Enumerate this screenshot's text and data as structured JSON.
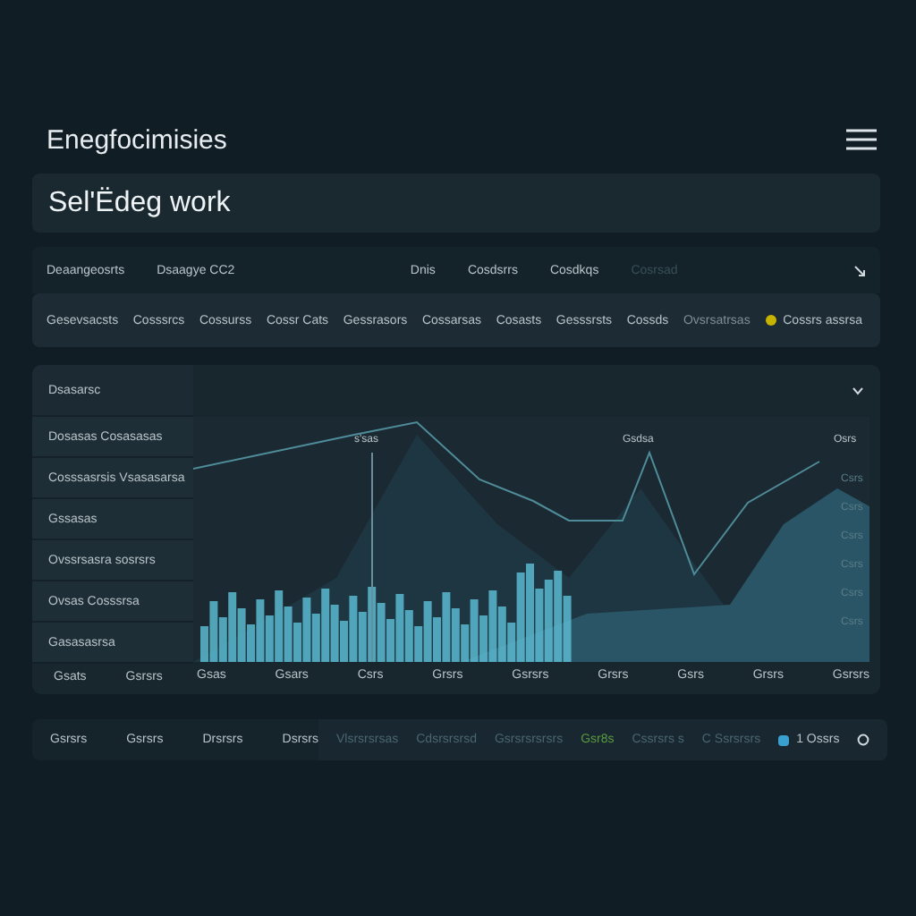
{
  "app_title": "Enegfocimisies",
  "heading": "Sel'Ëdeg work",
  "filter_row": {
    "left": [
      "Deaangeosrts",
      "Dsaagye CC2"
    ],
    "right": [
      "Dnis",
      "Cosdsrrs",
      "Cosdkqs",
      "Cosrsad"
    ]
  },
  "summary_row": {
    "items": [
      "Gesevsacsts",
      "Cosssrcs",
      "Cossurss",
      "Cossr Cats",
      "Gessrasors",
      "Cossarsas",
      "Cosasts",
      "Gesssrsts",
      "Cossds",
      "Ovsrsatrsas"
    ],
    "status": {
      "label": "Cossrs assrsa",
      "color": "#c8b400"
    }
  },
  "panel": {
    "title": "Dsasarsc",
    "list": [
      "Dosasas Cosasasas",
      "Cosssasrsis Vsasasarsa",
      "Gssasas",
      "Ovssrsasra sosrsrs",
      "Ovsas Cosssrsa",
      "Gasasasrsa"
    ],
    "x_labels_left": [
      "Gsats",
      "Gsrsrs"
    ],
    "chart": {
      "peak_labels": [
        "s'sas",
        "Gsdsa",
        "Osrs"
      ],
      "y_labels": [
        "Csrs",
        "Csrs",
        "Csrs",
        "Csrs",
        "Csrs",
        "Csrs"
      ],
      "x_labels": [
        "Gsas",
        "Gsars",
        "Csrs",
        "Grsrs",
        "Gsrsrs",
        "Grsrs",
        "Gsrs",
        "Grsrs",
        "Gsrsrs"
      ]
    }
  },
  "footer": {
    "left": [
      "Gsrsrs",
      "Gsrsrs",
      "Drsrsrs",
      "Dsrsrs"
    ],
    "right": [
      {
        "text": "Vlsrsrsrsas",
        "color": "#4a6670"
      },
      {
        "text": "Cdsrsrsrsd",
        "color": "#4a6670"
      },
      {
        "text": "Gsrsrsrsrsrs",
        "color": "#4a6670"
      },
      {
        "text": "Gsr8s",
        "color": "#5a9a40"
      },
      {
        "text": "Cssrsrs s",
        "color": "#4a6670"
      },
      {
        "text": "C Ssrsrsrs",
        "color": "#4a6670"
      }
    ],
    "badge": "1 Ossrs"
  }
}
